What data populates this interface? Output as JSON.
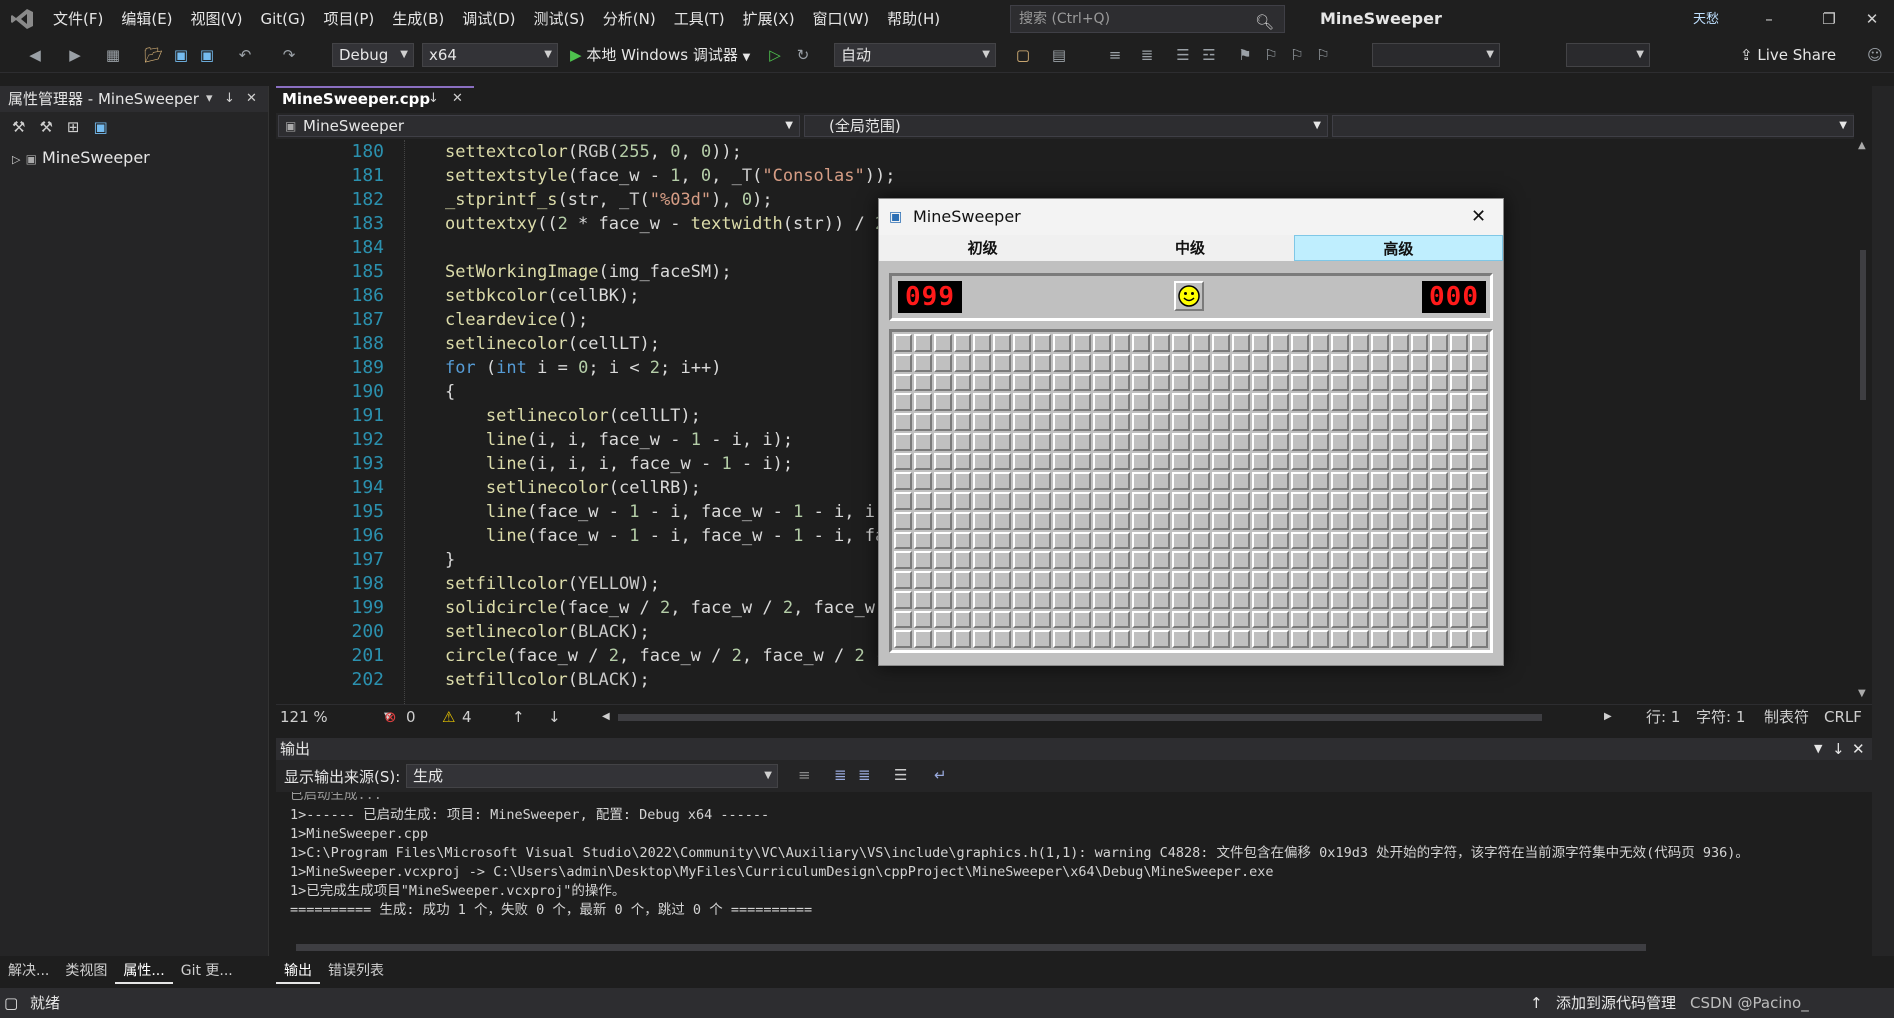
{
  "menu": {
    "items": [
      "文件(F)",
      "编辑(E)",
      "视图(V)",
      "Git(G)",
      "项目(P)",
      "生成(B)",
      "调试(D)",
      "测试(S)",
      "分析(N)",
      "工具(T)",
      "扩展(X)",
      "窗口(W)",
      "帮助(H)"
    ],
    "search_placeholder": "搜索 (Ctrl+Q)",
    "app_title": "MineSweeper",
    "user_badge": "天愁"
  },
  "toolbar": {
    "config": "Debug",
    "platform": "x64",
    "run_label": "本地 Windows 调试器",
    "auto_label": "自动",
    "live_share": "Live Share"
  },
  "left_panel": {
    "title": "属性管理器 - MineSweeper",
    "tree_root": "MineSweeper",
    "bottom_tabs": [
      "解决...",
      "类视图",
      "属性...",
      "Git 更..."
    ]
  },
  "editor": {
    "tab_title": "MineSweeper.cpp",
    "nav_project": "MineSweeper",
    "nav_scope": "(全局范围)",
    "line_numbers": [
      "180",
      "181",
      "182",
      "183",
      "184",
      "185",
      "186",
      "187",
      "188",
      "189",
      "190",
      "191",
      "192",
      "193",
      "194",
      "195",
      "196",
      "197",
      "198",
      "199",
      "200",
      "201",
      "202"
    ],
    "zoom": "121 %",
    "errors": "0",
    "warnings": "4",
    "row": "行: 1",
    "col": "字符: 1",
    "tabs_mode": "制表符",
    "eol": "CRLF"
  },
  "output": {
    "title": "输出",
    "source_label": "显示输出来源(S):",
    "source_value": "生成",
    "lines": [
      "1>------ 已启动生成: 项目: MineSweeper, 配置: Debug x64 ------",
      "1>MineSweeper.cpp",
      "1>C:\\Program Files\\Microsoft Visual Studio\\2022\\Community\\VC\\Auxiliary\\VS\\include\\graphics.h(1,1): warning C4828: 文件包含在偏移 0x19d3 处开始的字符，该字符在当前源字符集中无效(代码页 936)。",
      "1>MineSweeper.vcxproj -> C:\\Users\\admin\\Desktop\\MyFiles\\CurriculumDesign\\cppProject\\MineSweeper\\x64\\Debug\\MineSweeper.exe",
      "1>已完成生成项目\"MineSweeper.vcxproj\"的操作。",
      "========== 生成: 成功 1 个，失败 0 个，最新 0 个，跳过 0 个 =========="
    ],
    "tabs": [
      "输出",
      "错误列表"
    ]
  },
  "status": {
    "ready": "就绪",
    "source_control": "添加到源代码管理",
    "watermark": "CSDN @Pacino_"
  },
  "minesweeper": {
    "title": "MineSweeper",
    "tabs": [
      "初级",
      "中级",
      "高级"
    ],
    "selected_tab": "高级",
    "mine_counter": "099",
    "timer": "000",
    "rows": 16,
    "cols": 30
  },
  "colors": {
    "accent": "#8a6fc2",
    "lcd_text": "#ff1a1a",
    "selected_tab_bg": "#bfeefe"
  }
}
